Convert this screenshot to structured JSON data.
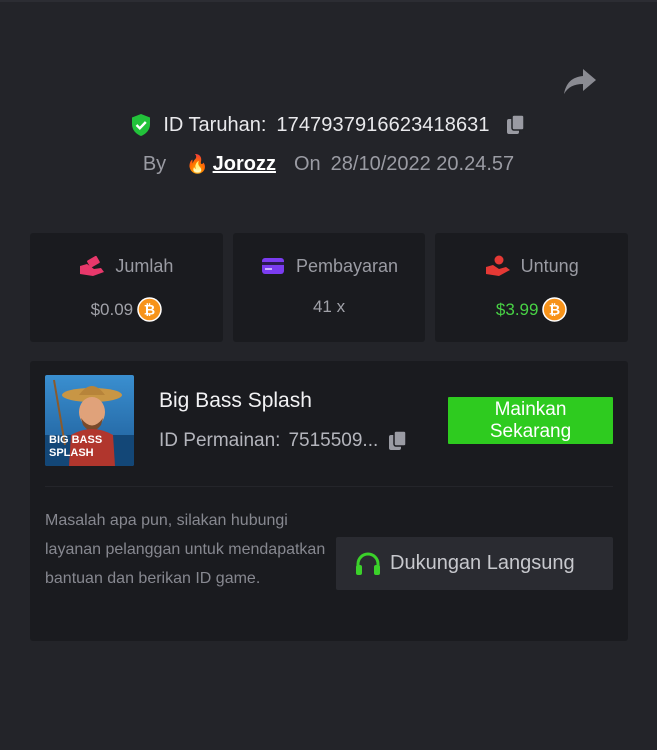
{
  "header": {
    "bet_label": "ID Taruhan:",
    "bet_id": "1747937916623418631",
    "by_label": "By",
    "username": "Jorozz",
    "user_emoji": "🔥",
    "on_label": "On",
    "datetime": "28/10/2022 20.24.57"
  },
  "stats": [
    {
      "label": "Jumlah",
      "value": "$0.09",
      "icon": "bet-hand-icon"
    },
    {
      "label": "Pembayaran",
      "value": "41 x",
      "icon": "card-icon"
    },
    {
      "label": "Untung",
      "value": "$3.99",
      "icon": "profit-hand-icon"
    }
  ],
  "game": {
    "title": "Big Bass Splash",
    "id_label": "ID Permainan:",
    "id_value": "7515509...",
    "thumb_text_line1": "BIG BASS",
    "thumb_text_line2": "SPLASH",
    "play_label_line1": "Mainkan",
    "play_label_line2": "Sekarang",
    "help_text": "Masalah apa pun, silakan hubungi layanan pelanggan untuk mendapatkan bantuan dan berikan ID game.",
    "support_label": "Dukungan Langsung"
  },
  "colors": {
    "background": "#232429",
    "card": "#1a1b1f",
    "accent_green": "#2ecb1f",
    "profit_green": "#48d145",
    "coin_orange": "#f7931a",
    "icon_pink": "#e8386b",
    "icon_purple": "#7b3cf0",
    "icon_red": "#e53935"
  }
}
